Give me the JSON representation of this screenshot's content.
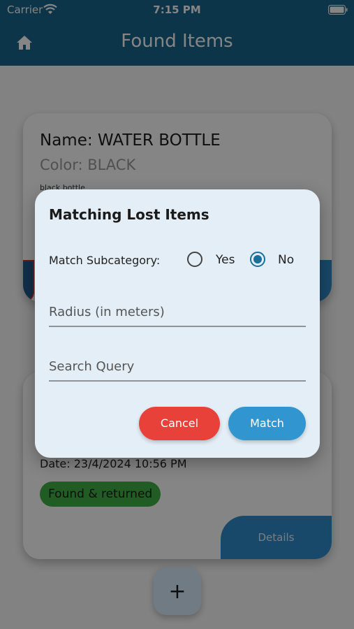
{
  "status_bar": {
    "carrier": "Carrier",
    "time": "7:15 PM"
  },
  "app_bar": {
    "title": "Found Items"
  },
  "cards": [
    {
      "name": "Name: WATER BOTTLE",
      "color": "Color: BLACK",
      "description": "black bottle"
    },
    {
      "date": "Date:  23/4/2024 10:56 PM",
      "status": "Found & returned",
      "details_label": "Details"
    }
  ],
  "fab": {
    "label": "+"
  },
  "dialog": {
    "title": "Matching Lost Items",
    "subcategory_label": "Match Subcategory:",
    "options": [
      "Yes",
      "No"
    ],
    "selected": "No",
    "radius_placeholder": "Radius (in meters)",
    "query_placeholder": "Search Query",
    "cancel_label": "Cancel",
    "match_label": "Match"
  },
  "colors": {
    "primary": "#18668f",
    "cancel": "#e8413a",
    "match": "#3196cf",
    "status_badge": "#3fb043"
  }
}
